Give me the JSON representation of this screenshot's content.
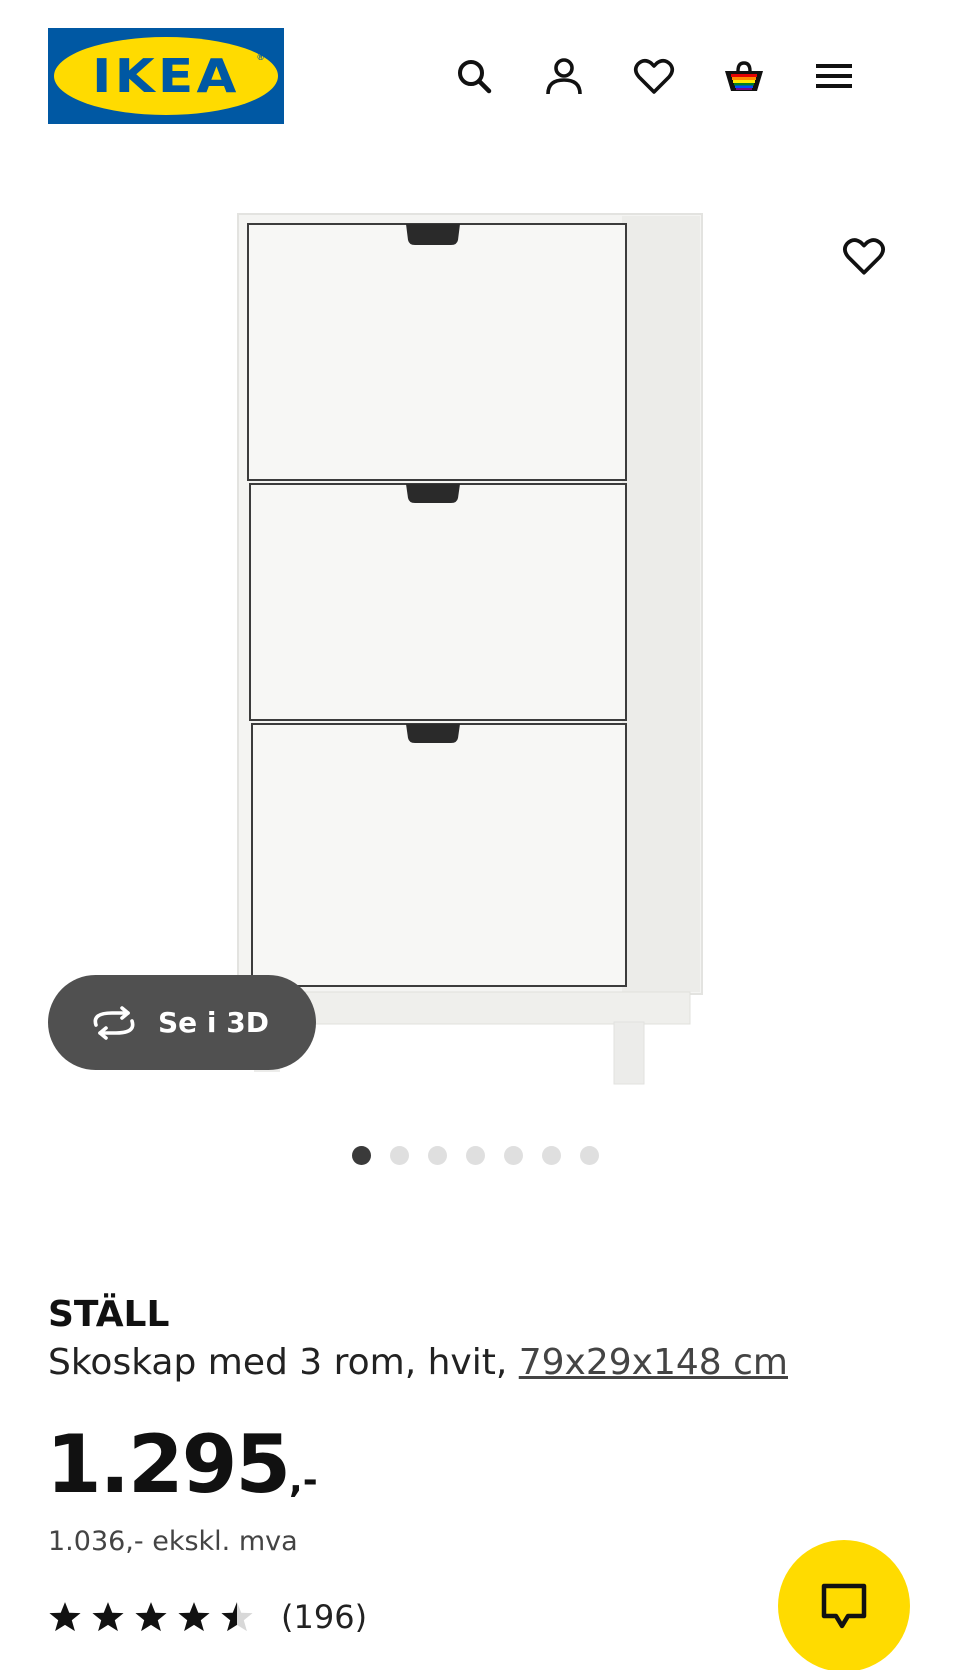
{
  "header": {
    "logo_text": "IKEA",
    "logo_reg": "®",
    "icons": [
      "search-icon",
      "account-icon",
      "favorites-icon",
      "shopping-bag-icon",
      "menu-icon"
    ]
  },
  "media": {
    "view_3d_label": "Se i 3D",
    "carousel": {
      "total": 7,
      "active": 1
    }
  },
  "product": {
    "name": "STÄLL",
    "description": "Skoskap med 3 rom, hvit, ",
    "dimensions": "79x29x148 cm",
    "price_integer": "1.295",
    "price_suffix": ",-",
    "price_ex_vat": "1.036,- ekskl. mva",
    "rating": 4.5,
    "review_count": "(196)"
  },
  "colors": {
    "brand_blue": "#0058a3",
    "brand_yellow": "#ffdb00",
    "pill_bg": "#505050"
  }
}
